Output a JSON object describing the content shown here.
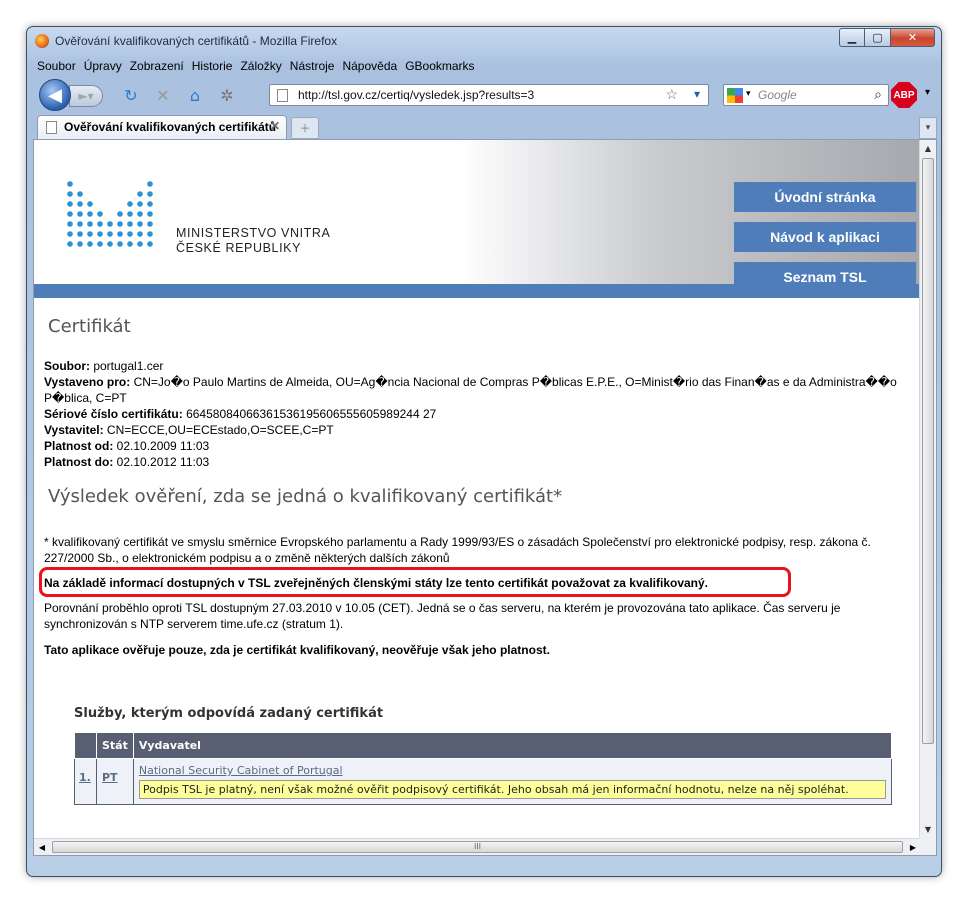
{
  "window": {
    "title": "Ověřování kvalifikovaných certifikátů - Mozilla Firefox"
  },
  "menu": [
    "Soubor",
    "Úpravy",
    "Zobrazení",
    "Historie",
    "Záložky",
    "Nástroje",
    "Nápověda",
    "GBookmarks"
  ],
  "navbar": {
    "url": "http://tsl.gov.cz/certiq/vysledek.jsp?results=3",
    "search_placeholder": "Google",
    "adblock_label": "ABP"
  },
  "tab": {
    "label": "Ověřování kvalifikovaných certifikátů"
  },
  "site": {
    "logo_line1": "MINISTERSTVO VNITRA",
    "logo_line2": "ČESKÉ REPUBLIKY",
    "nav": [
      "Úvodní stránka",
      "Návod k aplikaci",
      "Seznam TSL"
    ],
    "accent_color": "#4f7db9"
  },
  "certificate": {
    "heading": "Certifikát",
    "soubor_label": "Soubor:",
    "soubor_value": " portugal1.cer",
    "vystaveno_label": "Vystaveno pro:",
    "vystaveno_value": " CN=Jo�o Paulo Martins de Almeida, OU=Ag�ncia Nacional de Compras P�blicas E.P.E., O=Minist�rio das Finan�as e da Administra��o P�blica, C=PT",
    "serial_label": "Sériové číslo certifikátu:",
    "serial_value": " 66458084066361536195606555605989244 27",
    "vystavitel_label": "Vystavitel:",
    "vystavitel_value": " CN=ECCE,OU=ECEstado,O=SCEE,C=PT",
    "od_label": "Platnost od:",
    "od_value": " 02.10.2009 11:03",
    "do_label": "Platnost do:",
    "do_value": " 02.10.2012 11:03"
  },
  "result": {
    "heading": "Výsledek ověření, zda se jedná o kvalifikovaný certifikát*",
    "footnote": "* kvalifikovaný certifikát ve smyslu směrnice Evropského parlamentu a Rady 1999/93/ES o zásadách Společenství pro elektronické podpisy, resp. zákona č. 227/2000 Sb., o elektronickém podpisu a o změně některých dalších zákonů",
    "verdict": "Na základě informací dostupných v TSL zveřejněných členskými státy lze tento certifikát považovat za kvalifikovaný.",
    "comparison": "Porovnání proběhlo oproti TSL dostupným 27.03.2010 v 10.05 (CET). Jedná se o čas serveru, na kterém je provozována tato aplikace. Čas serveru je synchronizován s NTP serverem time.ufe.cz (stratum 1).",
    "disclaimer": "Tato aplikace ověřuje pouze, zda je certifikát kvalifikovaný, neověřuje však jeho platnost."
  },
  "services": {
    "heading": "Služby, kterým odpovídá zadaný certifikát",
    "columns": [
      "",
      "Stát",
      "Vydavatel"
    ],
    "rows": [
      {
        "num": "1.",
        "state": "PT",
        "issuer": "National Security Cabinet of Portugal",
        "note": "Podpis TSL je platný, není však možné ověřit podpisový certifikát. Jeho obsah má jen informační hodnotu, nelze na něj spoléhat."
      }
    ]
  },
  "scroll": {
    "hthumb_grip": "III"
  }
}
